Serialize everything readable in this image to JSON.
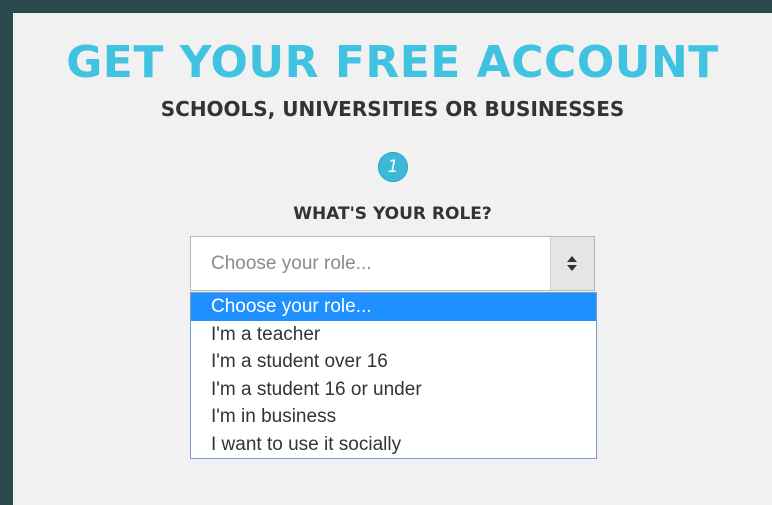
{
  "header": {
    "title": "GET YOUR FREE ACCOUNT",
    "subtitle": "SCHOOLS, UNIVERSITIES OR BUSINESSES"
  },
  "step": {
    "number": "1",
    "question": "WHAT'S YOUR ROLE?"
  },
  "role_select": {
    "current_value": "Choose your role...",
    "icon": "sort-arrows-icon",
    "options": [
      "Choose your role...",
      "I'm a teacher",
      "I'm a student over 16",
      "I'm a student 16 or under",
      "I'm in business",
      "I want to use it socially"
    ],
    "highlighted_index": 0
  },
  "colors": {
    "accent": "#3fc3e0",
    "badge": "#3cb9d9",
    "highlight": "#1e90ff",
    "frame": "#2b4a4f",
    "panel": "#f1f1f1"
  }
}
